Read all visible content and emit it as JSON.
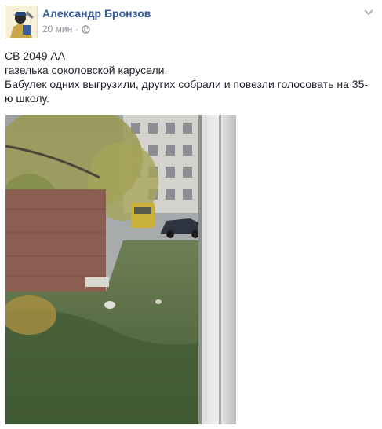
{
  "post": {
    "author": "Александр Бронзов",
    "time": "20 мин",
    "separator": "·",
    "privacy_icon": "globe-icon",
    "menu_icon": "chevron-down-icon",
    "text_lines": [
      "СВ 2049 АА",
      "газелька соколовской карусели.",
      "Бабулек одних выгрузили, других собрали и повезли голосовать на 35-",
      "ю школу."
    ]
  },
  "colors": {
    "author_link": "#365899",
    "meta_gray": "#90949c",
    "body_text": "#1d2129"
  }
}
